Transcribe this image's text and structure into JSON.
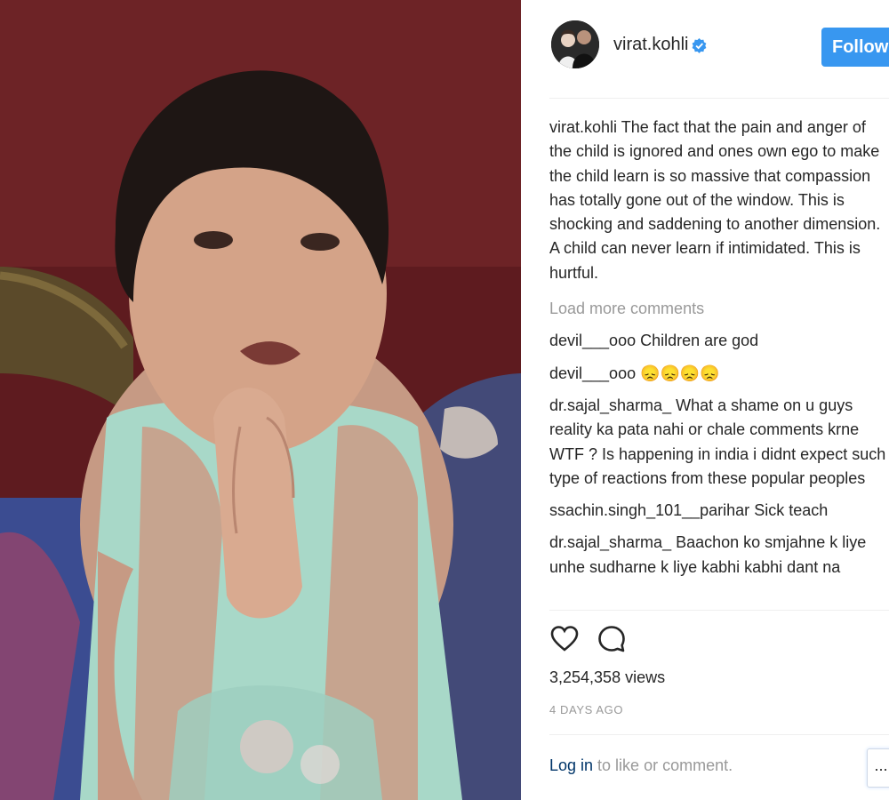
{
  "post": {
    "username": "virat.kohli",
    "follow_label": "Follow",
    "caption": "The fact that the pain and anger of the child is ignored and ones own ego to make the child learn is so massive that compassion has totally gone out of the window. This is shocking and saddening to another dimension. A child can never learn if intimidated. This is hurtful.",
    "load_more": "Load more comments",
    "comments": [
      {
        "user": "devil___ooo",
        "text": "Children are god"
      },
      {
        "user": "devil___ooo",
        "text": "😞😞😞😞"
      },
      {
        "user": "dr.sajal_sharma_",
        "text": "What a shame on u guys reality ka pata nahi or chale comments krne WTF ? Is happening in india i didnt expect such type of reactions from these popular peoples"
      },
      {
        "user": "ssachin.singh_101__parihar",
        "text": "Sick teach"
      },
      {
        "user": "dr.sajal_sharma_",
        "text": "Baachon ko smjahne k liye unhe sudharne k liye kabhi kabhi dant na"
      }
    ],
    "views": "3,254,358 views",
    "time_ago": "4 DAYS AGO",
    "login_link": "Log in",
    "login_suffix": " to like or comment.",
    "more_label": "..."
  },
  "icons": {
    "heart": "heart-icon",
    "comment": "comment-icon",
    "verified": "verified-badge-icon"
  },
  "colors": {
    "accent": "#3897f0",
    "link": "#003569",
    "muted": "#999999"
  }
}
